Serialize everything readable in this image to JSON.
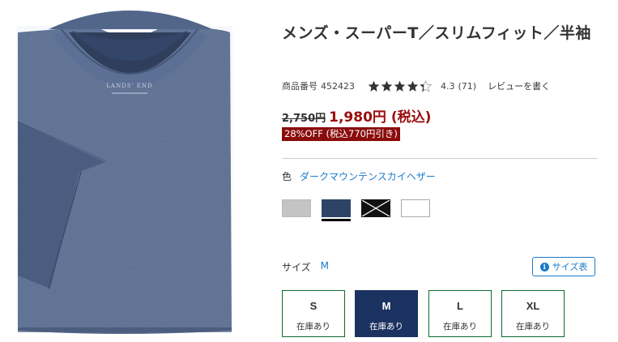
{
  "product": {
    "title": "メンズ・スーパーT／スリムフィット／半袖",
    "sku_label": "商品番号",
    "sku": "452423",
    "rating": "4.3",
    "review_count": "(71)",
    "write_review": "レビューを書く",
    "stars_filled": 4.3
  },
  "price": {
    "original": "2,750円",
    "sale": "1,980円 (税込)",
    "discount": "28%OFF (税込770円引き)"
  },
  "color": {
    "label": "色",
    "selected": "ダークマウンテンスカイヘザー",
    "swatches": [
      "#c4c4c4",
      "#2c4466",
      "#111111",
      "#ffffff"
    ]
  },
  "size": {
    "label": "サイズ",
    "selected": "M",
    "chart_label": "サイズ表",
    "options": [
      {
        "name": "S",
        "stock": "在庫あり"
      },
      {
        "name": "M",
        "stock": "在庫あり"
      },
      {
        "name": "L",
        "stock": "在庫あり"
      },
      {
        "name": "XL",
        "stock": "在庫あり"
      }
    ]
  },
  "image": {
    "brand": "LANDS' END"
  },
  "colors": {
    "sale_red": "#9b0d0d",
    "link_blue": "#1a7ac9",
    "selected_navy": "#1c3260",
    "box_border": "#0a6b2c"
  }
}
